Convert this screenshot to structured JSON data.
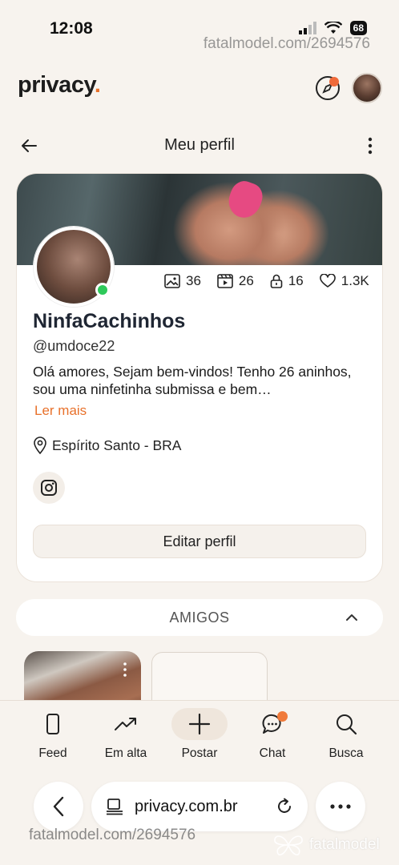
{
  "status_bar": {
    "time": "12:08",
    "battery": "68"
  },
  "watermark": {
    "top": "fatalmodel.com/2694576",
    "bottom": "fatalmodel.com/2694576",
    "brand": "fatalmodel"
  },
  "header": {
    "logo": "privacy",
    "logo_dot": "."
  },
  "page": {
    "title": "Meu perfil"
  },
  "profile": {
    "stats": {
      "photos": "36",
      "videos": "26",
      "locked": "16",
      "likes": "1.3K"
    },
    "display_name": "NinfaCachinhos",
    "username": "@umdoce22",
    "bio": "Olá amores, Sejam bem-vindos! Tenho 26 aninhos, sou uma ninfetinha submissa e bem…",
    "read_more": "Ler mais",
    "location": "Espírito Santo - BRA",
    "edit_button": "Editar perfil"
  },
  "friends": {
    "label": "AMIGOS"
  },
  "bottom_nav": [
    {
      "label": "Feed",
      "icon": "phone-icon"
    },
    {
      "label": "Em alta",
      "icon": "trending-icon"
    },
    {
      "label": "Postar",
      "icon": "plus-icon"
    },
    {
      "label": "Chat",
      "icon": "chat-icon"
    },
    {
      "label": "Busca",
      "icon": "search-icon"
    }
  ],
  "browser": {
    "url": "privacy.com.br"
  },
  "colors": {
    "accent": "#e8712b",
    "online": "#2ec95a",
    "background": "#f7f3ee"
  }
}
